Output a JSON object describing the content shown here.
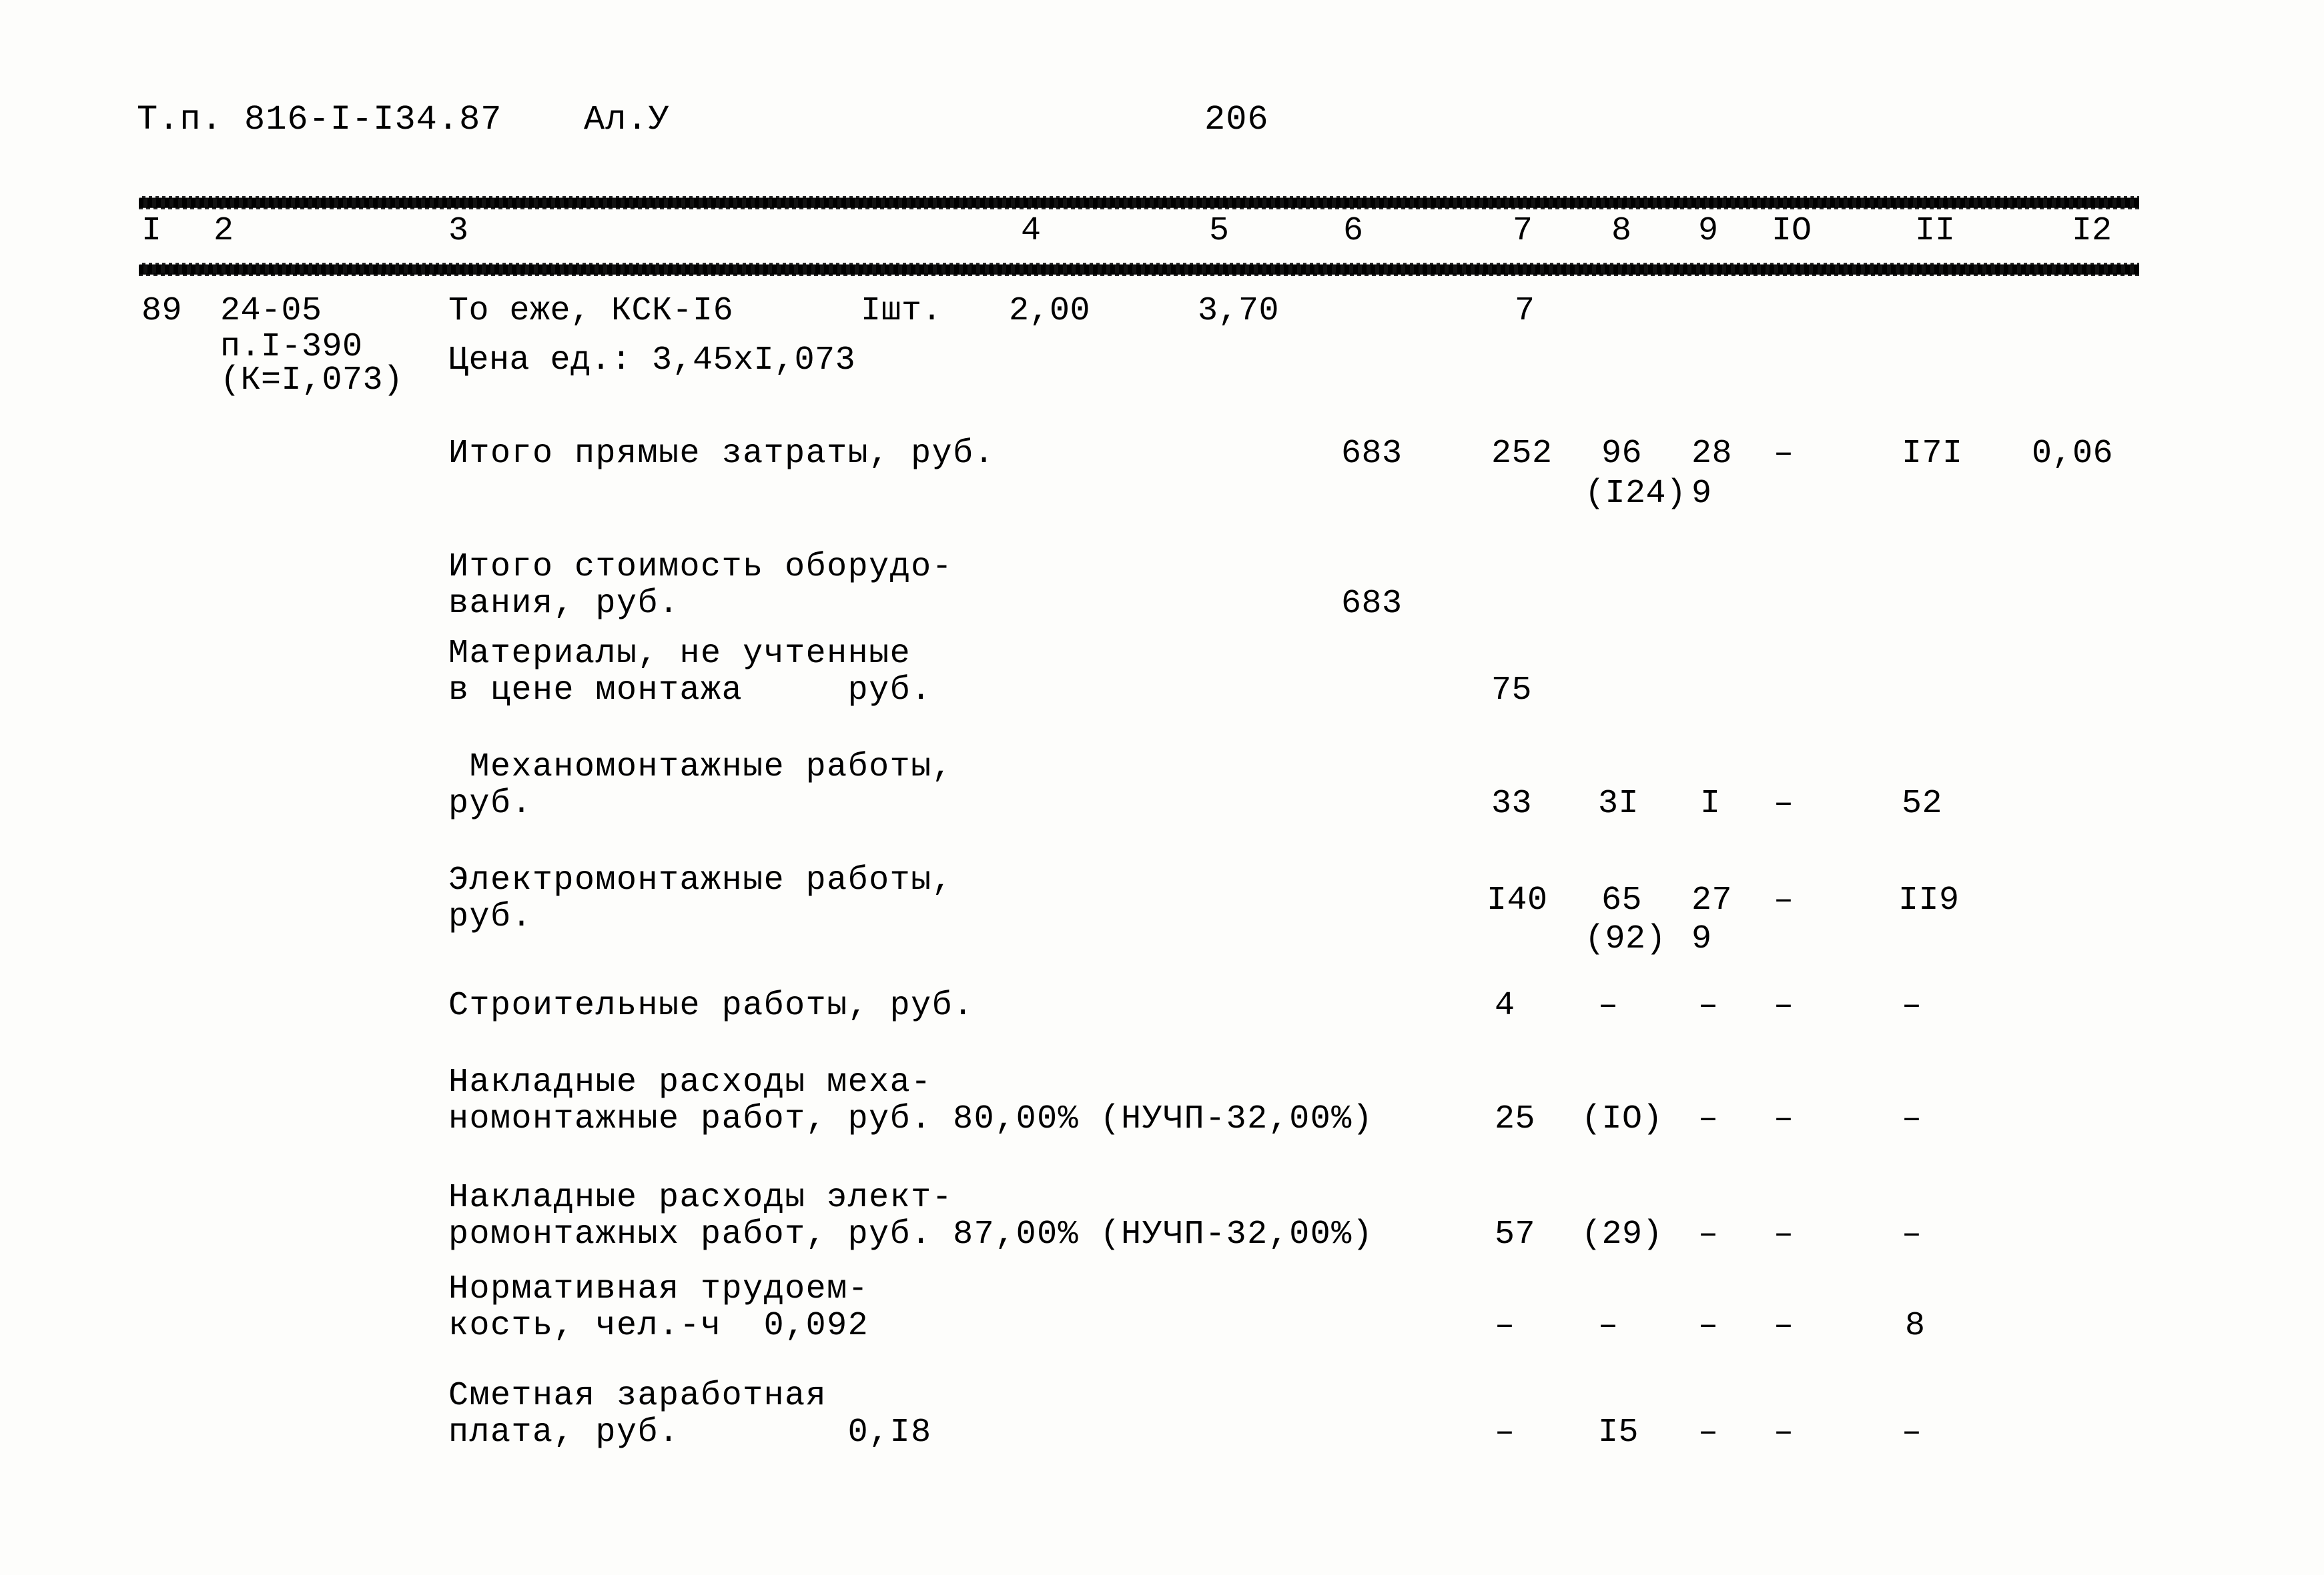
{
  "document": {
    "code": "Т.п. 816-I-I34.87",
    "sheet": "Ал.У",
    "page_number": "206"
  },
  "table": {
    "column_headers": [
      "I",
      "2",
      "3",
      "4",
      "5",
      "6",
      "7",
      "8",
      "9",
      "IO",
      "II",
      "I2"
    ],
    "item": {
      "no": "89",
      "code_line1": "24-05",
      "code_line2": "п.I-390",
      "code_line3": "(К=I,073)",
      "description": "То еже, КСК-I6",
      "unit": "Iшт.",
      "quantity": "2,00",
      "price": "3,70",
      "col7": "7",
      "price_note": "Цена ед.: 3,45хI,073"
    },
    "rows": [
      {
        "label_line1": "Итого прямые затраты, руб.",
        "label_line2": "",
        "c6": "683",
        "c7": "252",
        "c8": "96",
        "c8b": "(I24)",
        "c9": "28",
        "c9b": "9",
        "c10": "–",
        "c11": "I7I",
        "c12": "0,06"
      },
      {
        "label_line1": "Итого стоимость оборудо-",
        "label_line2": "вания, руб.",
        "c6": "683",
        "c7": "",
        "c8": "",
        "c8b": "",
        "c9": "",
        "c9b": "",
        "c10": "",
        "c11": "",
        "c12": ""
      },
      {
        "label_line1": "Материалы, не учтенные",
        "label_line2": "в цене монтажа     руб.",
        "c6": "",
        "c7": "75",
        "c8": "",
        "c8b": "",
        "c9": "",
        "c9b": "",
        "c10": "",
        "c11": "",
        "c12": ""
      },
      {
        "label_line1": " Механомонтажные работы,",
        "label_line2": "руб.",
        "c6": "",
        "c7": "33",
        "c8": "3I",
        "c8b": "",
        "c9": "I",
        "c9b": "",
        "c10": "–",
        "c11": "52",
        "c12": ""
      },
      {
        "label_line1": "Электромонтажные работы,",
        "label_line2": "руб.",
        "c6": "",
        "c7": "I40",
        "c8": "65",
        "c8b": "(92)",
        "c9": "27",
        "c9b": "9",
        "c10": "–",
        "c11": "II9",
        "c12": ""
      },
      {
        "label_line1": "Строительные работы, руб.",
        "label_line2": "",
        "c6": "",
        "c7": "4",
        "c8": "–",
        "c8b": "",
        "c9": "–",
        "c9b": "",
        "c10": "–",
        "c11": "–",
        "c12": ""
      },
      {
        "label_line1": "Накладные расходы меха-",
        "label_line2": "номонтажные работ, руб. 80,00% (НУЧП-32,00%)",
        "c6": "",
        "c7": "25",
        "c8": "(IO)",
        "c8b": "",
        "c9": "–",
        "c9b": "",
        "c10": "–",
        "c11": "–",
        "c12": ""
      },
      {
        "label_line1": "Накладные расходы элект-",
        "label_line2": "ромонтажных работ, руб. 87,00% (НУЧП-32,00%)",
        "c6": "",
        "c7": "57",
        "c8": "(29)",
        "c8b": "",
        "c9": "–",
        "c9b": "",
        "c10": "–",
        "c11": "–",
        "c12": ""
      },
      {
        "label_line1": "Нормативная трудоем-",
        "label_line2": "кость, чел.-ч  0,092",
        "c6": "",
        "c7": "–",
        "c8": "–",
        "c8b": "",
        "c9": "–",
        "c9b": "",
        "c10": "–",
        "c11": "8",
        "c12": ""
      },
      {
        "label_line1": "Сметная заработная",
        "label_line2": "плата, руб.        0,I8",
        "c6": "",
        "c7": "–",
        "c8": "I5",
        "c8b": "",
        "c9": "–",
        "c9b": "",
        "c10": "–",
        "c11": "–",
        "c12": ""
      }
    ]
  }
}
